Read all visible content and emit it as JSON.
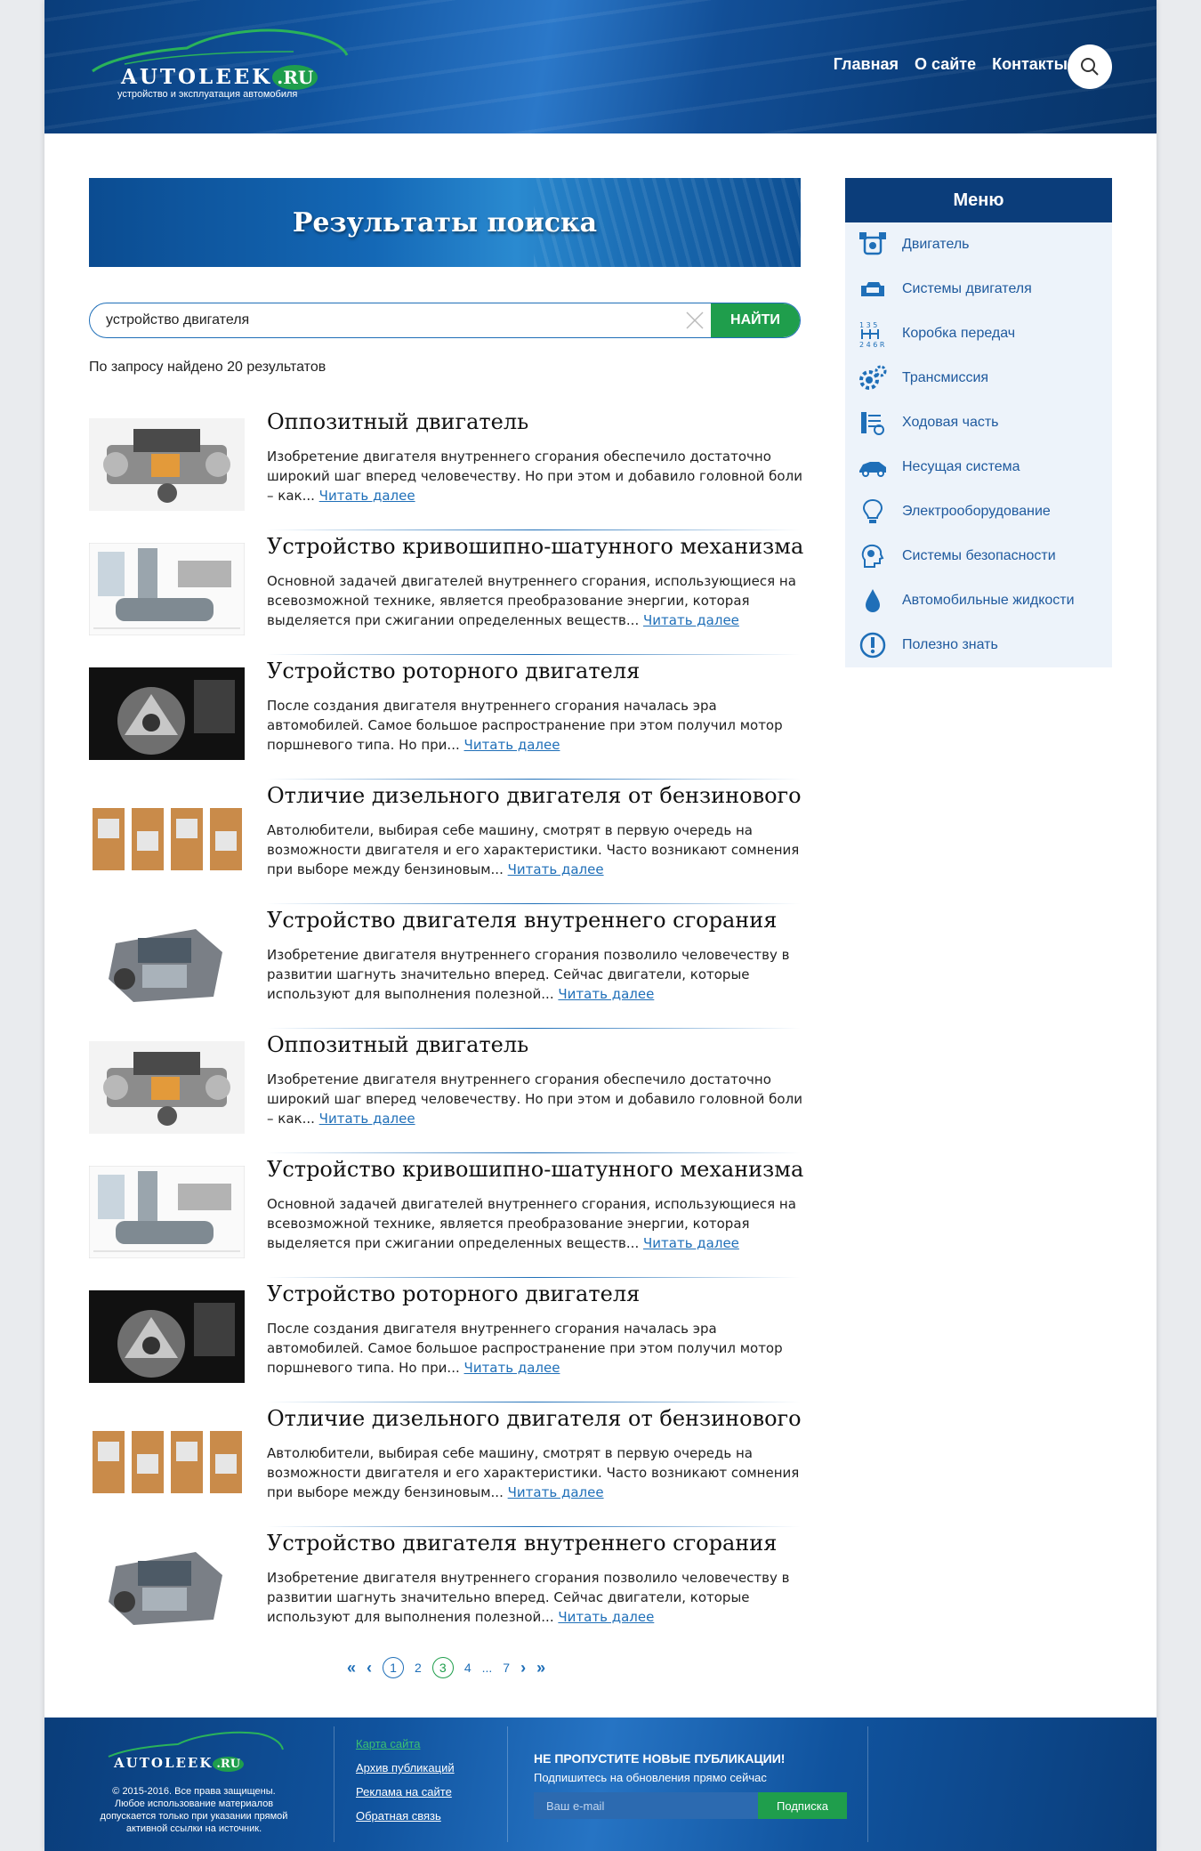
{
  "header": {
    "logo_text": "AUTOLEEK",
    "logo_suffix": ".RU",
    "logo_tagline": "устройство и эксплуатация автомобиля",
    "nav": [
      "Главная",
      "О сайте",
      "Контакты"
    ]
  },
  "banner": {
    "title": "Результаты поиска"
  },
  "search": {
    "value": "устройство двигателя",
    "button": "НАЙТИ"
  },
  "found_text": "По запросу найдено 20 результатов",
  "read_more": "Читать далее",
  "results": [
    {
      "title": "Оппозитный двигатель",
      "text": "Изобретение двигателя внутреннего сгорания обеспечило достаточно широкий шаг вперед человечеству. Но при этом и добавило головной боли – как...",
      "image": "boxer-engine-image"
    },
    {
      "title": "Устройство кривошипно-шатунного механизма",
      "text": "Основной задачей двигателей внутреннего сгорания, использующиеся на всевозможной технике, является преобразование энергии, которая выделяется при сжигании определенных веществ...",
      "image": "crank-mechanism-image"
    },
    {
      "title": "Устройство роторного двигателя",
      "text": "После создания двигателя внутреннего сгорания началась эра автомобилей. Самое большое распространение при этом получил мотор поршневого типа. Но при...",
      "image": "rotary-engine-image"
    },
    {
      "title": "Отличие дизельного двигателя от бензинового",
      "text": "Автолюбители, выбирая себе машину, смотрят в первую очередь на возможности двигателя и его характеристики. Часто возникают сомнения при выборе между бензиновым...",
      "image": "diesel-cycle-image"
    },
    {
      "title": "Устройство двигателя внутреннего сгорания",
      "text": "Изобретение двигателя внутреннего сгорания позволило человечеству в развитии шагнуть значительно вперед. Сейчас двигатели, которые используют для выполнения полезной...",
      "image": "ice-engine-image"
    },
    {
      "title": "Оппозитный двигатель",
      "text": "Изобретение двигателя внутреннего сгорания обеспечило достаточно широкий шаг вперед человечеству. Но при этом и добавило головной боли – как...",
      "image": "boxer-engine-image"
    },
    {
      "title": "Устройство кривошипно-шатунного механизма",
      "text": "Основной задачей двигателей внутреннего сгорания, использующиеся на всевозможной технике, является преобразование энергии, которая выделяется при сжигании определенных веществ...",
      "image": "crank-mechanism-image"
    },
    {
      "title": "Устройство роторного двигателя",
      "text": "После создания двигателя внутреннего сгорания началась эра автомобилей. Самое большое распространение при этом получил мотор поршневого типа. Но при...",
      "image": "rotary-engine-image"
    },
    {
      "title": "Отличие дизельного двигателя от бензинового",
      "text": "Автолюбители, выбирая себе машину, смотрят в первую очередь на возможности двигателя и его характеристики. Часто возникают сомнения при выборе между бензиновым...",
      "image": "diesel-cycle-image"
    },
    {
      "title": "Устройство двигателя внутреннего сгорания",
      "text": "Изобретение двигателя внутреннего сгорания позволило человечеству в развитии шагнуть значительно вперед. Сейчас двигатели, которые используют для выполнения полезной...",
      "image": "ice-engine-image"
    }
  ],
  "pagination": {
    "first": "«",
    "prev": "‹",
    "pages": [
      "1",
      "2",
      "3",
      "4"
    ],
    "current": "3",
    "ellipsis": "...",
    "last_page": "7",
    "next": "›",
    "last": "»"
  },
  "menu": {
    "title": "Меню",
    "items": [
      {
        "label": "Двигатель",
        "icon": "engine-icon"
      },
      {
        "label": "Системы двигателя",
        "icon": "engine-block-icon"
      },
      {
        "label": "Коробка передач",
        "icon": "gearbox-icon"
      },
      {
        "label": "Трансмиссия",
        "icon": "gears-icon"
      },
      {
        "label": "Ходовая часть",
        "icon": "suspension-icon"
      },
      {
        "label": "Несущая система",
        "icon": "car-body-icon"
      },
      {
        "label": "Электрооборудование",
        "icon": "lightbulb-icon"
      },
      {
        "label": "Системы безопасности",
        "icon": "safety-head-icon"
      },
      {
        "label": "Автомобильные жидкости",
        "icon": "drop-icon"
      },
      {
        "label": "Полезно знать",
        "icon": "exclamation-icon"
      }
    ]
  },
  "footer": {
    "logo_text": "AUTOLEEK",
    "logo_suffix": ".RU",
    "copyright": "© 2015-2016. Все права защищены. Любое использование материалов допускается только при указании прямой активной ссылки на источник.",
    "links": [
      "Карта сайта",
      "Архив публикаций",
      "Реклама на сайте",
      "Обратная связь"
    ],
    "subscribe_title": "НЕ ПРОПУСТИТЕ НОВЫЕ ПУБЛИКАЦИИ!",
    "subscribe_text": "Подпишитесь на обновления прямо сейчас",
    "email_placeholder": "Ваш e-mail",
    "subscribe_button": "Подписка"
  },
  "colors": {
    "brand_blue": "#0b3d7a",
    "link_blue": "#1f6fb8",
    "accent_green": "#1f9e4c"
  }
}
